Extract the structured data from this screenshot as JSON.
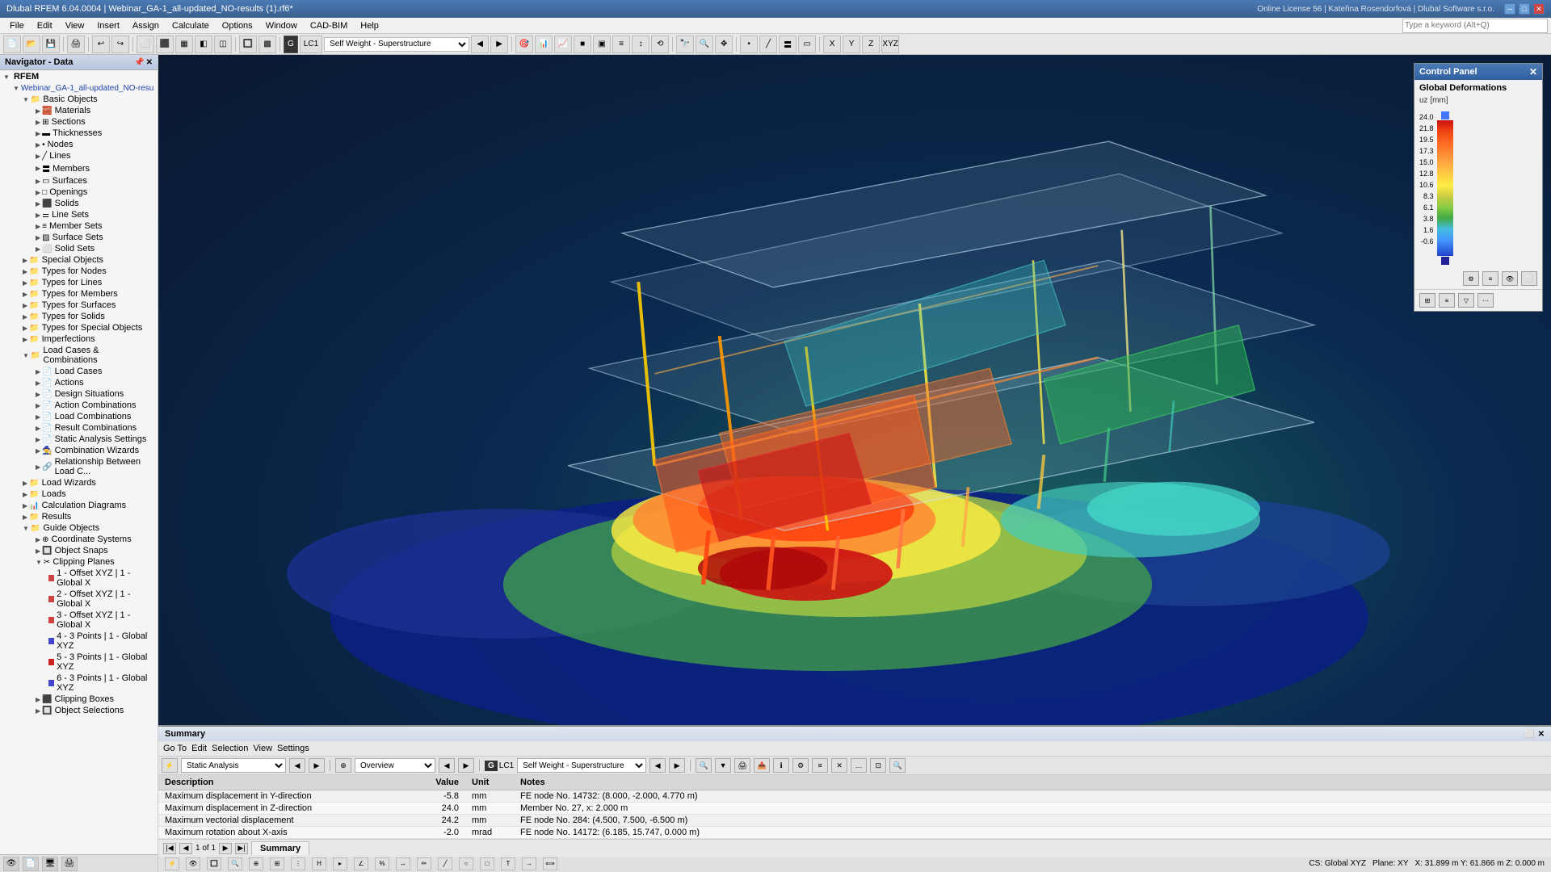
{
  "titlebar": {
    "title": "Dlubal RFEM 6.04.0004 | Webinar_GA-1_all-updated_NO-results (1).rf6*",
    "search_placeholder": "Type a keyword (Alt+Q)",
    "license": "Online License 56 | Kateřina Rosendorfová | Dlubal Software s.r.o."
  },
  "menu": {
    "items": [
      "File",
      "Edit",
      "View",
      "Insert",
      "Assign",
      "Calculate",
      "Options",
      "Window",
      "CAD-BIM",
      "Help"
    ]
  },
  "toolbar": {
    "lc_label": "LC1",
    "lc_name": "Self Weight - Superstructure"
  },
  "navigator": {
    "title": "Navigator - Data",
    "rfem_label": "RFEM",
    "project": "Webinar_GA-1_all-updated_NO-resu",
    "basic_objects": {
      "label": "Basic Objects",
      "children": [
        "Materials",
        "Sections",
        "Thicknesses",
        "Nodes",
        "Lines",
        "Members",
        "Surfaces",
        "Openings",
        "Solids",
        "Line Sets",
        "Member Sets",
        "Surface Sets",
        "Solid Sets"
      ]
    },
    "special_objects": {
      "label": "Special Objects"
    },
    "types_for_nodes": {
      "label": "Types for Nodes"
    },
    "types_for_lines": {
      "label": "Types for Lines"
    },
    "types_for_members": {
      "label": "Types for Members"
    },
    "types_for_surfaces": {
      "label": "Types for Surfaces"
    },
    "types_for_solids": {
      "label": "Types for Solids"
    },
    "types_for_special": {
      "label": "Types for Special Objects"
    },
    "imperfections": {
      "label": "Imperfections"
    },
    "load_cases_combinations": {
      "label": "Load Cases & Combinations",
      "children": [
        "Load Cases",
        "Actions",
        "Design Situations",
        "Action Combinations",
        "Load Combinations",
        "Result Combinations",
        "Static Analysis Settings",
        "Combination Wizards",
        "Relationship Between Load C..."
      ]
    },
    "load_wizards": {
      "label": "Load Wizards"
    },
    "loads": {
      "label": "Loads"
    },
    "calculation_diagrams": {
      "label": "Calculation Diagrams"
    },
    "results": {
      "label": "Results"
    },
    "guide_objects": {
      "label": "Guide Objects",
      "children": [
        "Coordinate Systems",
        "Object Snaps",
        "Clipping Planes"
      ]
    },
    "clipping_planes": {
      "items": [
        {
          "label": "1 - Offset XYZ | 1 - Global X",
          "color": "#cc4444"
        },
        {
          "label": "2 - Offset XYZ | 1 - Global X",
          "color": "#cc4444"
        },
        {
          "label": "3 - Offset XYZ | 1 - Global X",
          "color": "#cc4444"
        },
        {
          "label": "4 - 3 Points | 1 - Global XYZ",
          "color": "#4444cc"
        },
        {
          "label": "5 - 3 Points | 1 - Global XYZ",
          "color": "#cc2222"
        },
        {
          "label": "6 - 3 Points | 1 - Global XYZ",
          "color": "#4444cc"
        }
      ]
    },
    "clipping_boxes": {
      "label": "Clipping Boxes"
    },
    "object_selections": {
      "label": "Object Selections"
    }
  },
  "control_panel": {
    "title": "Control Panel",
    "section": "Global Deformations",
    "unit": "uz [mm]",
    "scale_values": [
      "24.0",
      "21.8",
      "19.5",
      "17.3",
      "15.0",
      "12.8",
      "10.6",
      "8.3",
      "6.1",
      "3.8",
      "1.6",
      "-0.6"
    ],
    "colors": [
      "#2244cc",
      "#2255ee",
      "#2277ff",
      "#4499ff",
      "#44bbff",
      "#44cccc",
      "#44bb88",
      "#44aa44",
      "#88cc44",
      "#cccc44",
      "#ffee44",
      "#ffcc44",
      "#ffaa44",
      "#ff8833",
      "#ff6622",
      "#ff4411",
      "#ee2211",
      "#cc1111",
      "#aa0808",
      "#880404"
    ],
    "top_dot_color": "#4477ff",
    "bottom_dot_color": "#222299"
  },
  "bottom_panel": {
    "title": "Summary",
    "menu_items": [
      "Go To",
      "Edit",
      "Selection",
      "View",
      "Settings"
    ],
    "analysis_type": "Static Analysis",
    "result_type": "Overview",
    "lc_label": "G LC1",
    "lc_name": "Self Weight - Superstructure",
    "table_headers": [
      "Description",
      "Value",
      "Unit",
      "Notes"
    ],
    "rows": [
      {
        "desc": "Maximum displacement in Y-direction",
        "value": "-5.8",
        "unit": "mm",
        "notes": "FE node No. 14732: (8.000, -2.000, 4.770 m)"
      },
      {
        "desc": "Maximum displacement in Z-direction",
        "value": "24.0",
        "unit": "mm",
        "notes": "Member No. 27, x: 2.000 m"
      },
      {
        "desc": "Maximum vectorial displacement",
        "value": "24.2",
        "unit": "mm",
        "notes": "FE node No. 284: (4.500, 7.500, -6.500 m)"
      },
      {
        "desc": "Maximum rotation about X-axis",
        "value": "-2.0",
        "unit": "mrad",
        "notes": "FE node No. 14172: (6.185, 15.747, 0.000 m)"
      }
    ],
    "page_info": "1 of 1",
    "tab": "Summary"
  },
  "statusbar": {
    "left": "CS: Global XYZ",
    "plane": "Plane: XY",
    "coords": "X: 31.899 m  Y: 61.866 m  Z: 0.000 m"
  }
}
